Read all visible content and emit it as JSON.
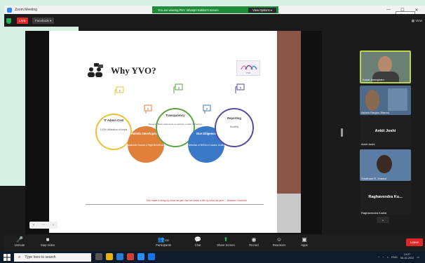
{
  "window": {
    "title": "Zoom Meeting",
    "banner_text": "You are viewing PKV .Bhanpri Kakkar's screen",
    "view_options_label": "View Options ▾",
    "minimize_tooltip": "Minimize"
  },
  "meeting": {
    "live_label": "LIVE",
    "facebook_label": "Facebook ▾",
    "view_label": "View"
  },
  "slide": {
    "title": "Why YVO?",
    "logo_text": "YVO",
    "circles": [
      {
        "title": "'0' Admin Cost",
        "body": "100% Utilization of funds",
        "color": "#e8c23a",
        "fill": "#ffffff",
        "flag": "1"
      },
      {
        "title": "Holistic Development",
        "body": "Sustainable Causes & Right Beneficiaries",
        "color": "#e0803a",
        "fill": "#e0803a",
        "flag": "2"
      },
      {
        "title": "Transparency",
        "body": "Receipts, Bank statements on website, emails, WhatsApp",
        "color": "#5aa340",
        "fill": "#ffffff",
        "flag": "3"
      },
      {
        "title": "Due Diligence",
        "body": "Selection of NGOs & Causes, Audits",
        "color": "#3a78c8",
        "fill": "#3a78c8",
        "flag": "4"
      },
      {
        "title": "Reporting",
        "body": "Monthly",
        "color": "#5a4aa0",
        "fill": "#ffffff",
        "flag": "5"
      }
    ],
    "quote": "\"We make a living by what we get; but we make a life by what we give\" - Winston Churchill"
  },
  "participants": [
    {
      "name": "Kunal Jasingham",
      "big_name": ""
    },
    {
      "name": "Ashish Ranjan Jhamol",
      "big_name": ""
    },
    {
      "name": "Ankit Joshi",
      "big_name": "Ankit Joshi"
    },
    {
      "name": "Shubham R. Jhamol",
      "big_name": ""
    },
    {
      "name": "Raghavendra Kudlai",
      "big_name": "Raghavendra Ku..."
    }
  ],
  "toolbar": {
    "unmute": "Unmute",
    "stop_video": "Stop Video",
    "participants": "Participants",
    "participants_count": "152",
    "chat": "Chat",
    "share_screen": "Share Screen",
    "record": "Record",
    "reactions": "Reactions",
    "apps": "Apps",
    "leave": "Leave"
  },
  "taskbar": {
    "search_placeholder": "Type here to search",
    "language": "ENG",
    "time": "19:07",
    "date": "06-16-2022"
  },
  "colors": {
    "zoom_green": "#1f8e3a",
    "live_red": "#e02828",
    "active_speaker": "#b7d64a"
  }
}
